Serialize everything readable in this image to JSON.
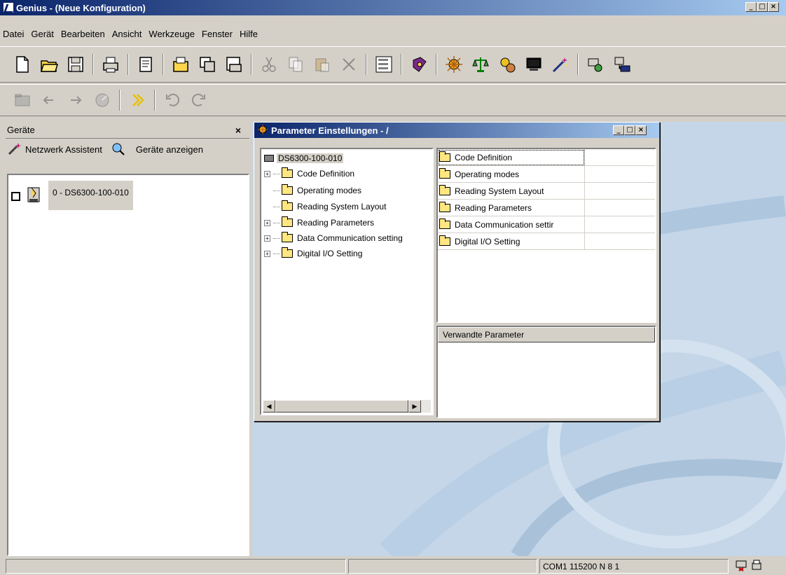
{
  "window": {
    "title": "Genius - (Neue Konfiguration)"
  },
  "menu": [
    "Datei",
    "Gerät",
    "Bearbeiten",
    "Ansicht",
    "Werkzeuge",
    "Fenster",
    "Hilfe"
  ],
  "toolbar1_icons": [
    "new-document-icon",
    "open-folder-icon",
    "save-icon",
    "print-icon",
    "properties-icon",
    "open-config-icon",
    "copy-config-icon",
    "save-config-icon",
    "cut-icon",
    "copy-icon",
    "paste-icon",
    "delete-icon",
    "tree-view-icon",
    "help-book-icon",
    "network-icon",
    "balance-icon",
    "settings-gear-icon",
    "monitor-icon",
    "wand-icon",
    "device-tools-icon",
    "network-device-icon"
  ],
  "toolbar2_icons": [
    "folder-icon",
    "back-arrow-icon",
    "forward-arrow-icon",
    "refresh-icon",
    "connect-icon",
    "undo-icon",
    "redo-icon"
  ],
  "devices_panel": {
    "title": "Geräte",
    "close": "×",
    "network_assistant": "Netzwerk Assistent",
    "show_devices": "Geräte anzeigen",
    "device_label": "0 - DS6300-100-010"
  },
  "param_window": {
    "title": "Parameter Einstellungen - /",
    "tree_root": "DS6300-100-010",
    "tree_items": [
      {
        "label": "Code Definition",
        "expandable": true
      },
      {
        "label": "Operating modes",
        "expandable": false
      },
      {
        "label": "Reading System Layout",
        "expandable": false
      },
      {
        "label": "Reading Parameters",
        "expandable": true
      },
      {
        "label": "Data Communication setting",
        "expandable": true
      },
      {
        "label": "Digital I/O Setting",
        "expandable": true
      }
    ],
    "list_items": [
      "Code Definition",
      "Operating modes",
      "Reading System Layout",
      "Reading Parameters",
      "Data Communication settir",
      "Digital I/O Setting"
    ],
    "related_header": "Verwandte Parameter"
  },
  "status": {
    "port": "COM1 115200 N 8 1"
  }
}
